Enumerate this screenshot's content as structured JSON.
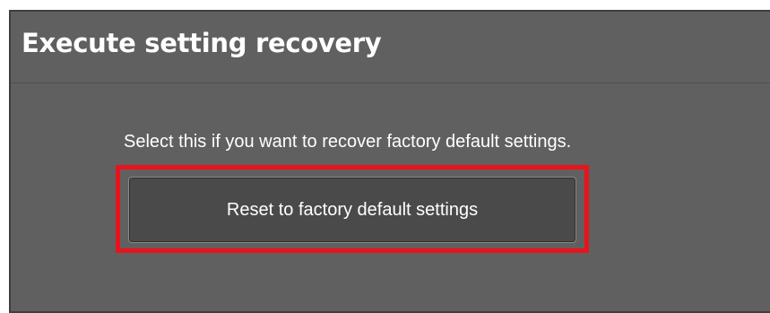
{
  "section": {
    "title": "Execute setting recovery",
    "description": "Select this if you want to recover factory default settings.",
    "reset_button_label": "Reset to factory default settings"
  },
  "colors": {
    "panel_background": "#606060",
    "button_background": "#4a4a4a",
    "highlight": "#e8141d",
    "text": "#ffffff"
  }
}
